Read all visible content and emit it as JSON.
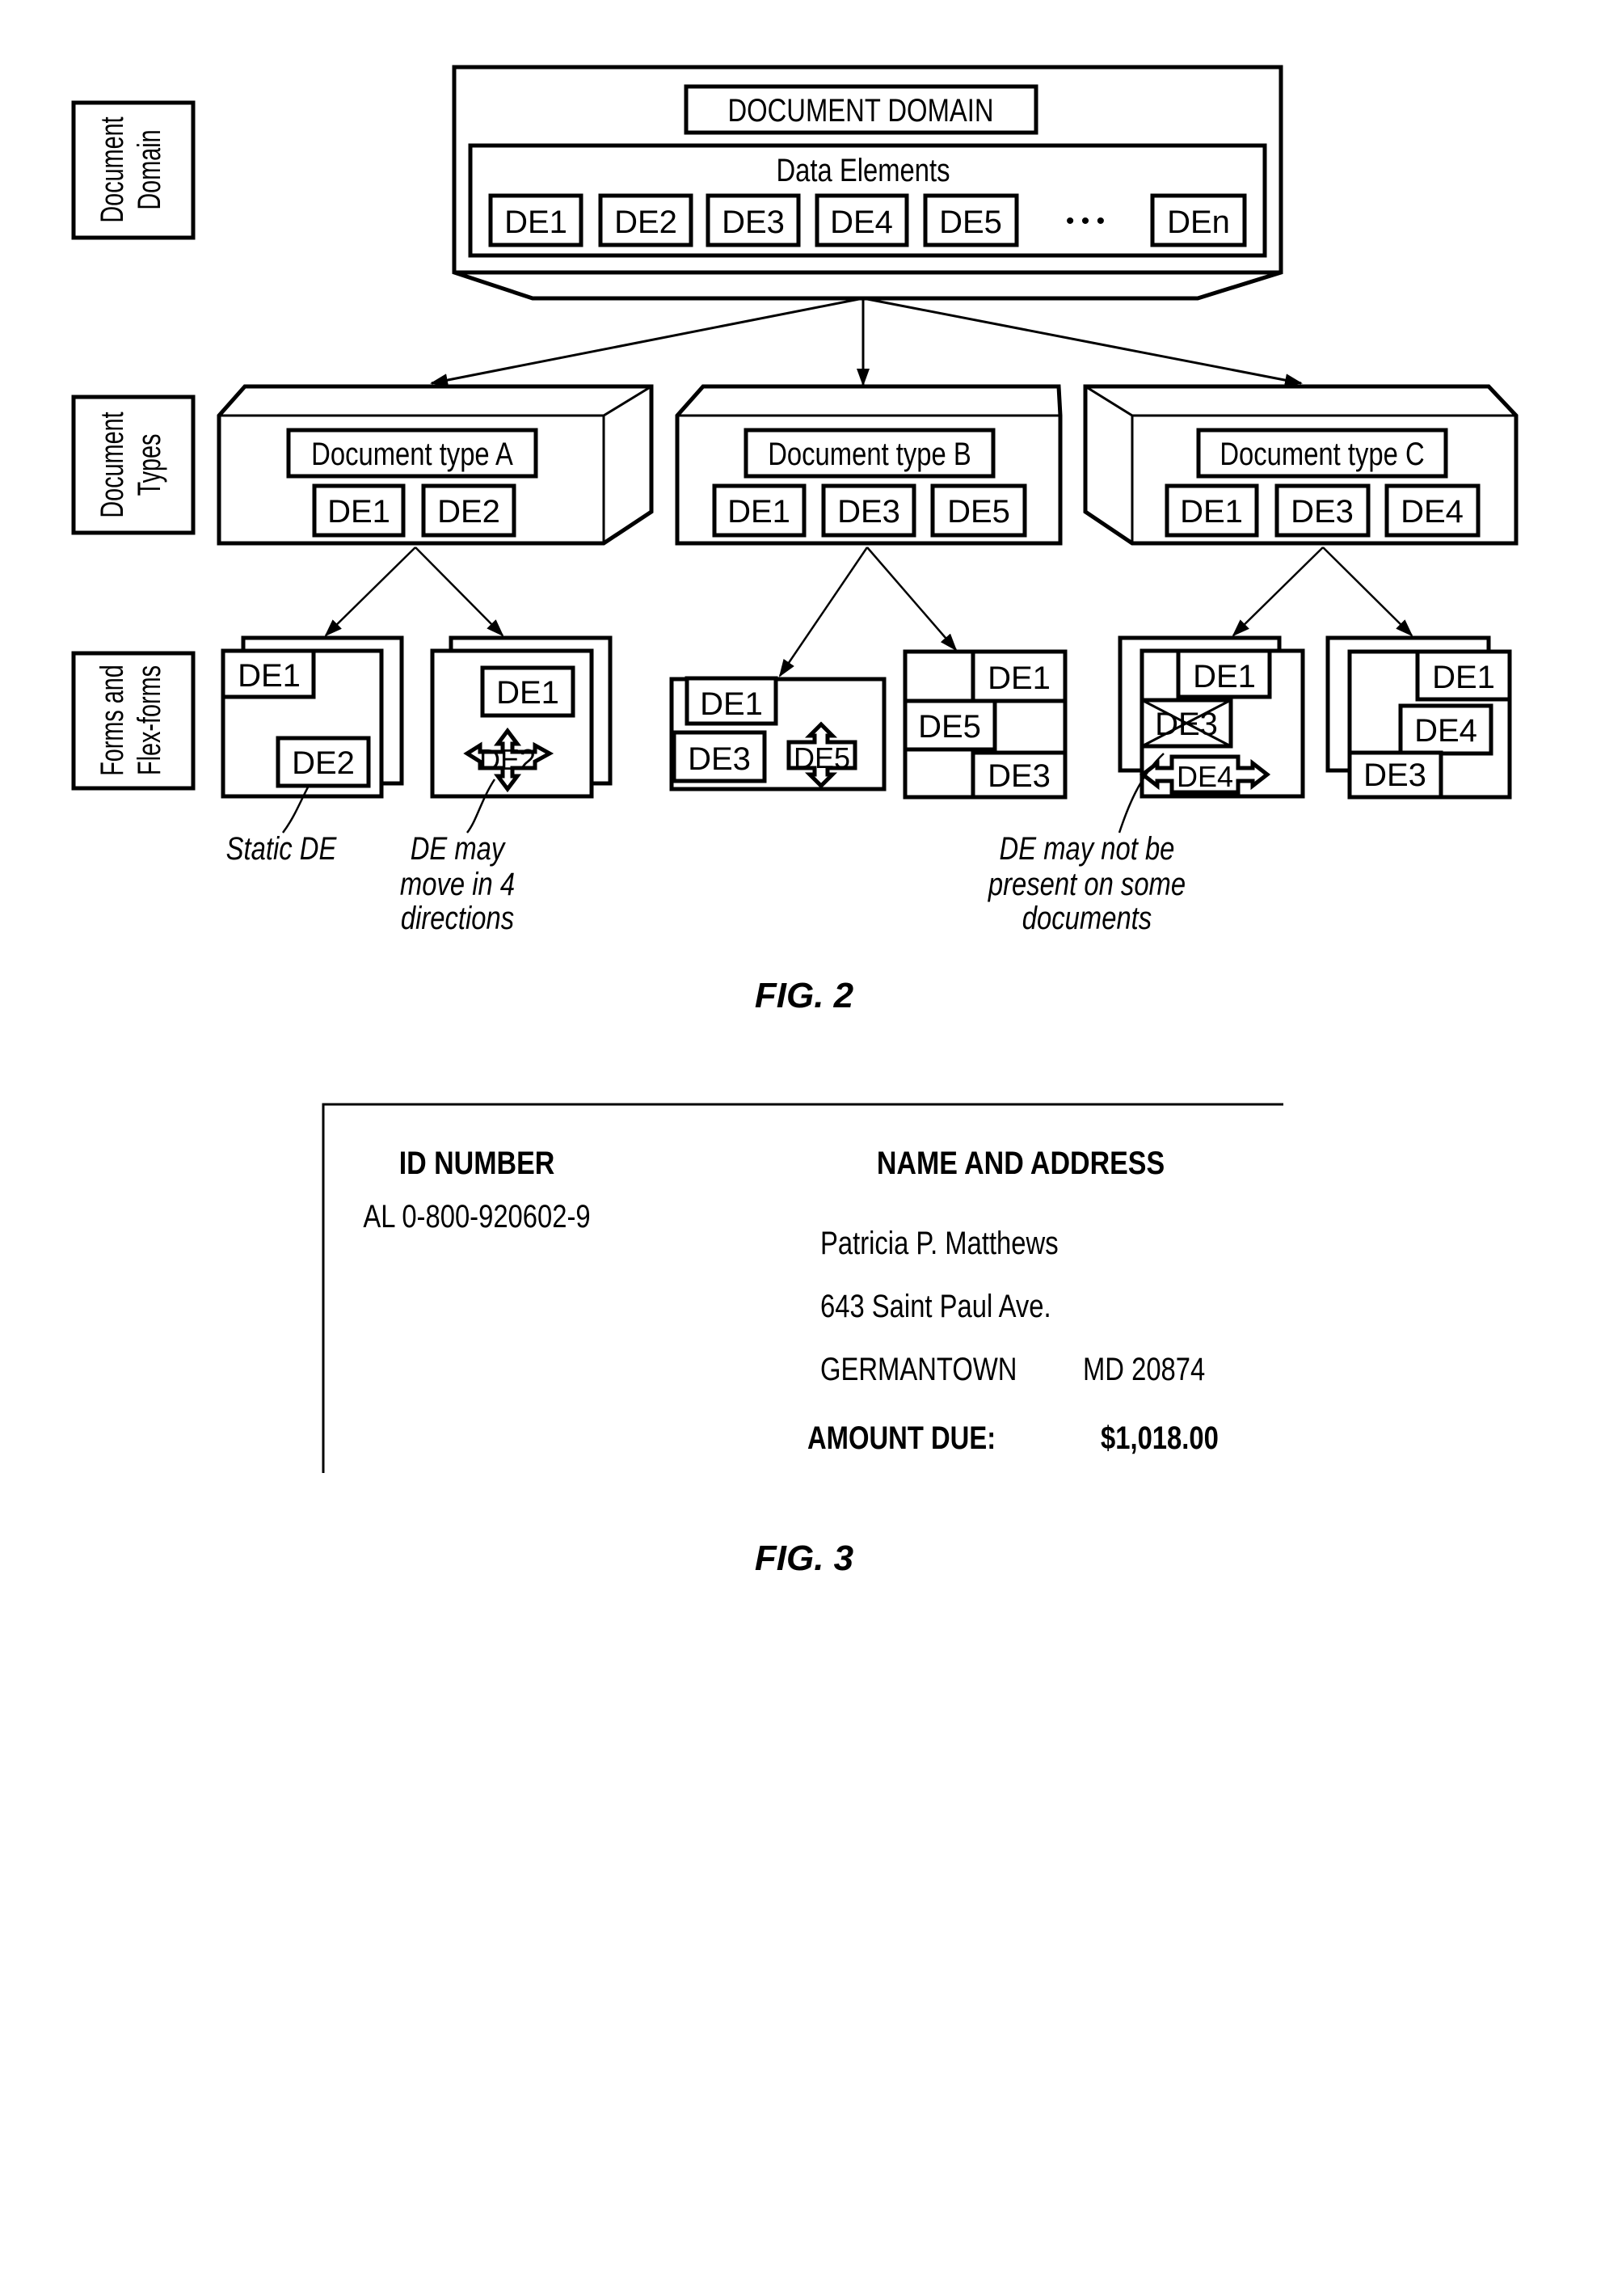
{
  "fig2": {
    "caption": "FIG. 2",
    "side_labels": {
      "domain": [
        "Document",
        "Domain"
      ],
      "types": [
        "Document",
        "Types"
      ],
      "forms": [
        "Forms and",
        "Flex-forms"
      ]
    },
    "domain": {
      "title": "DOCUMENT DOMAIN",
      "data_elements_label": "Data Elements",
      "elements": [
        "DE1",
        "DE2",
        "DE3",
        "DE4",
        "DE5",
        "DEn"
      ],
      "ellipsis": "• • •"
    },
    "types": [
      {
        "title": "Document type A",
        "elements": [
          "DE1",
          "DE2"
        ]
      },
      {
        "title": "Document type B",
        "elements": [
          "DE1",
          "DE3",
          "DE5"
        ]
      },
      {
        "title": "Document type C",
        "elements": [
          "DE1",
          "DE3",
          "DE4"
        ]
      }
    ],
    "forms": {
      "a1": {
        "de1": "DE1",
        "de2": "DE2"
      },
      "a2": {
        "de1": "DE1",
        "de2": "DE2"
      },
      "b1": {
        "de1": "DE1",
        "de3": "DE3",
        "de5": "DE5"
      },
      "b2": {
        "de1": "DE1",
        "de5": "DE5",
        "de3": "DE3"
      },
      "c1": {
        "de1": "DE1",
        "de3": "DE3",
        "de4": "DE4"
      },
      "c2": {
        "de1": "DE1",
        "de4": "DE4",
        "de3": "DE3"
      }
    },
    "annotations": {
      "static": [
        "Static DE"
      ],
      "move": [
        "DE may",
        "move in 4",
        "directions"
      ],
      "absent": [
        "DE may not be",
        "present on some",
        "documents"
      ]
    }
  },
  "fig3": {
    "caption": "FIG. 3",
    "id_header": "ID NUMBER",
    "id_value": "AL 0-800-920602-9",
    "name_header": "NAME AND ADDRESS",
    "name": "Patricia P. Matthews",
    "street": "643 Saint Paul Ave.",
    "city": "GERMANTOWN",
    "state_zip": "MD 20874",
    "amount_label": "AMOUNT DUE:",
    "amount_value": "$1,018.00"
  }
}
